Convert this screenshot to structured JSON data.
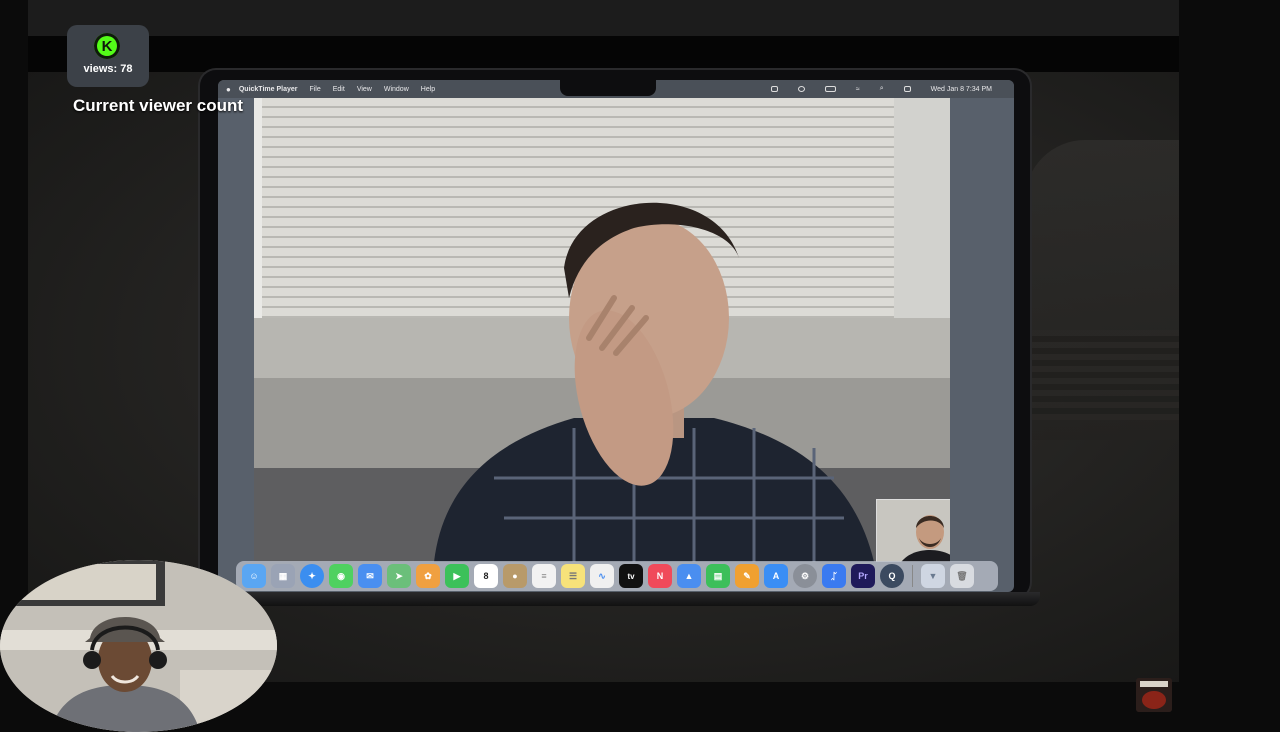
{
  "overlay": {
    "views_label": "views: 78",
    "caption": "Current viewer count",
    "logo_letter": "K",
    "logo_color": "#53fc18"
  },
  "macos": {
    "menubar": {
      "app_name": "QuickTime Player",
      "menus": [
        "File",
        "Edit",
        "View",
        "Window",
        "Help"
      ],
      "clock": "Wed Jan 8  7:34 PM"
    },
    "dock": {
      "calendar_day": "8",
      "apple_tv_label": "tv",
      "premiere_label": "Pr",
      "items": [
        {
          "name": "finder",
          "color": "#5aa6f2"
        },
        {
          "name": "launchpad",
          "color": "#9aa3b5"
        },
        {
          "name": "safari",
          "color": "#3b8ef0"
        },
        {
          "name": "messages",
          "color": "#4fd160"
        },
        {
          "name": "mail",
          "color": "#4a8ff0"
        },
        {
          "name": "maps",
          "color": "#6bbf7a"
        },
        {
          "name": "photos",
          "color": "#f0a040"
        },
        {
          "name": "facetime",
          "color": "#3cc15a"
        },
        {
          "name": "calendar",
          "color": "#ffffff"
        },
        {
          "name": "contacts",
          "color": "#b89a6a"
        },
        {
          "name": "reminders",
          "color": "#f2f2f2"
        },
        {
          "name": "notes",
          "color": "#f7e27a"
        },
        {
          "name": "freeform",
          "color": "#f0f0f0"
        },
        {
          "name": "apple-tv",
          "color": "#111111"
        },
        {
          "name": "news",
          "color": "#f04a5a"
        },
        {
          "name": "keynote",
          "color": "#4a8ef0"
        },
        {
          "name": "numbers",
          "color": "#3cbf5a"
        },
        {
          "name": "pages",
          "color": "#f0a030"
        },
        {
          "name": "app-store",
          "color": "#3a8ef5"
        },
        {
          "name": "system-settings",
          "color": "#8a8f98"
        },
        {
          "name": "bluetooth",
          "color": "#3a7af0"
        },
        {
          "name": "premiere-pro",
          "color": "#1f1a5a"
        },
        {
          "name": "quicktime",
          "color": "#3b4a60"
        }
      ]
    }
  }
}
